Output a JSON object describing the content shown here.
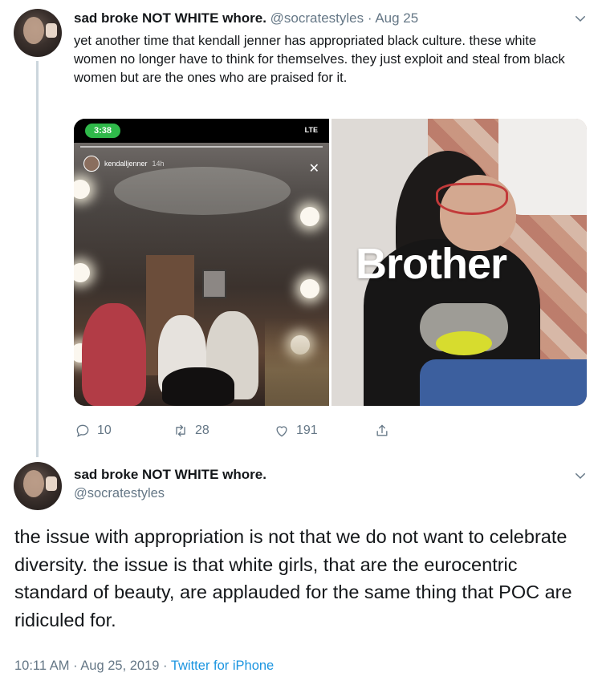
{
  "tweet1": {
    "display_name": "sad broke NOT WHITE whore.",
    "handle": "@socratestyles",
    "separator": "·",
    "date": "Aug 25",
    "text": "yet another time that kendall jenner has appropriated black culture. these white women no longer have to think for themselves. they just exploit and steal from black women but are the ones who are praised for it.",
    "media": {
      "left": {
        "status_time": "3:38",
        "status_signal": "LTE",
        "story_user": "kendalljenner",
        "story_age": "14h",
        "close_glyph": "✕"
      },
      "right": {
        "brand_text": "Brother"
      }
    },
    "actions": {
      "replies": "10",
      "retweets": "28",
      "likes": "191"
    }
  },
  "tweet2": {
    "display_name": "sad broke NOT WHITE whore.",
    "handle": "@socratestyles",
    "text": "the issue with appropriation is not that we do not want to celebrate diversity. the issue is that white girls, that are the eurocentric standard of beauty, are applauded for the same thing that POC are ridiculed for.",
    "time": "10:11 AM",
    "separator": "·",
    "date": "Aug 25, 2019",
    "source": "Twitter for iPhone"
  },
  "icons": [
    "reply-icon",
    "retweet-icon",
    "like-icon",
    "share-icon",
    "chevron-down-icon"
  ],
  "colors": {
    "link": "#1b95e0",
    "muted": "#657786",
    "text": "#14171a",
    "thread_line": "#ccd6dd"
  }
}
